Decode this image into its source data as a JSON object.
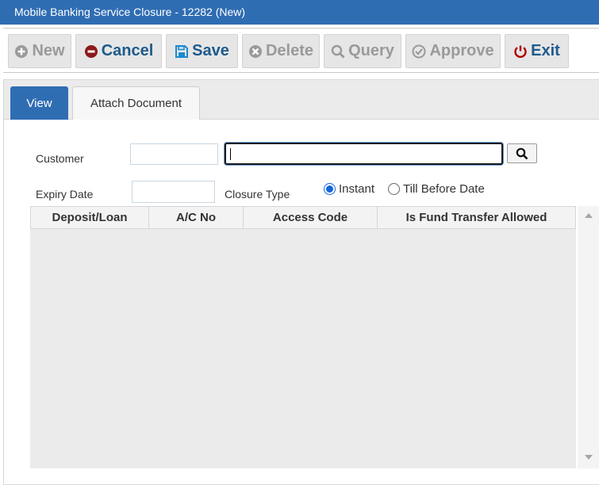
{
  "window": {
    "title": "Mobile Banking Service Closure - 12282 (New)"
  },
  "toolbar": {
    "new_label": "New",
    "cancel_label": "Cancel",
    "save_label": "Save",
    "delete_label": "Delete",
    "query_label": "Query",
    "approve_label": "Approve",
    "exit_label": "Exit"
  },
  "tabs": [
    {
      "label": "View",
      "active": true
    },
    {
      "label": "Attach Document",
      "active": false
    }
  ],
  "form": {
    "customer_label": "Customer",
    "customer_code": "",
    "customer_name": "",
    "expiry_label": "Expiry Date",
    "expiry_value": "",
    "closure_type_label": "Closure Type",
    "closure_options": [
      {
        "label": "Instant",
        "selected": true
      },
      {
        "label": "Till Before Date",
        "selected": false
      }
    ]
  },
  "grid": {
    "columns": [
      "Deposit/Loan",
      "A/C No",
      "Access Code",
      "Is Fund Transfer Allowed"
    ],
    "rows": []
  },
  "colors": {
    "title_bar": "#2f6db3",
    "active_tab": "#2f6db3",
    "button_text": "#1d5a8c",
    "cancel_icon": "#8b1a1a",
    "exit_icon": "#b00000",
    "disabled_text": "#9a9a9a",
    "radio_selected": "#1565d8"
  },
  "icons": {
    "new": "plus-circle-icon",
    "cancel": "minus-circle-icon",
    "save": "floppy-disk-icon",
    "delete": "x-circle-icon",
    "query": "magnifier-icon",
    "approve": "check-circle-icon",
    "exit": "power-icon",
    "search": "search-icon"
  }
}
